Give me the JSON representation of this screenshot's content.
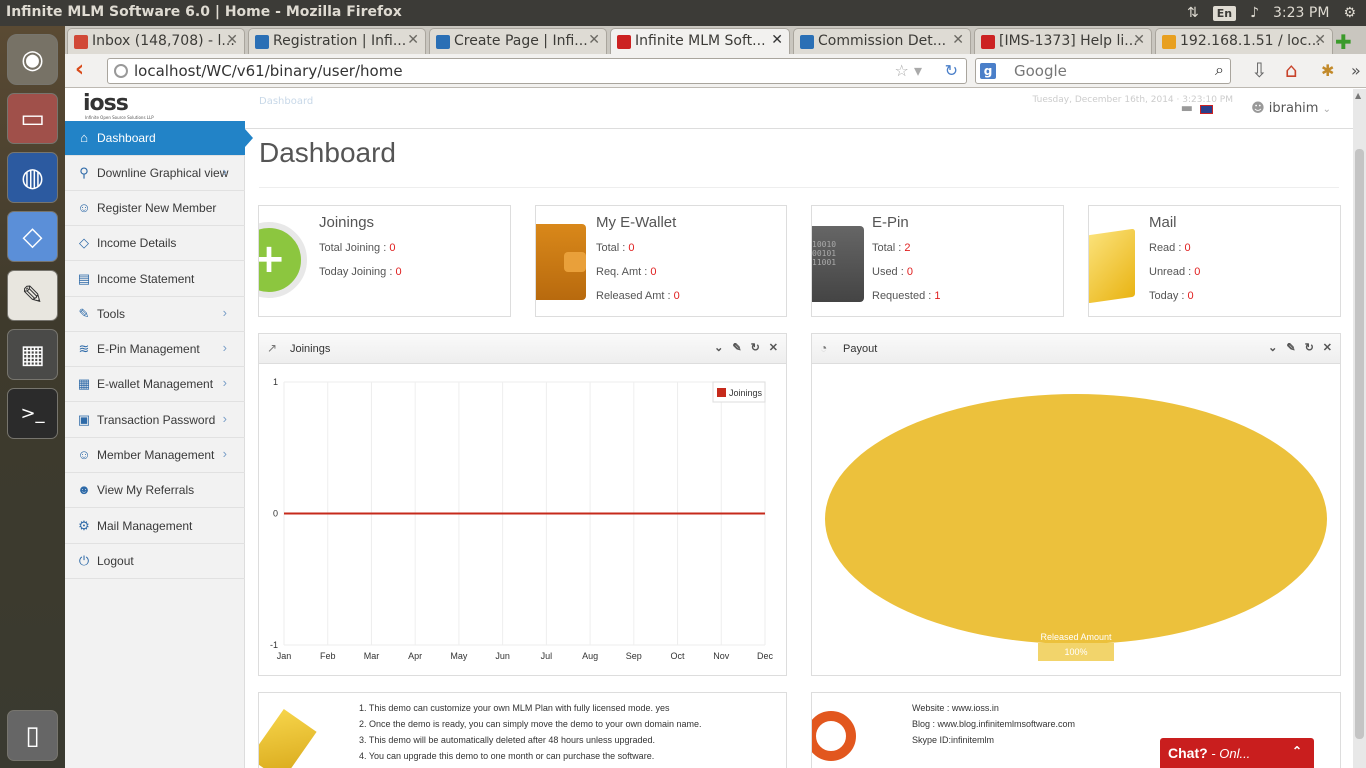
{
  "window": {
    "title": "Infinite MLM Software 6.0 | Home - Mozilla Firefox",
    "lang": "En",
    "clock": "3:23 PM"
  },
  "tabs": [
    {
      "label": "Inbox (148,708) - l...",
      "color": "#d14836"
    },
    {
      "label": "Registration | Infi...",
      "color": "#2a6fb5"
    },
    {
      "label": "Create Page | Infi...",
      "color": "#2a6fb5"
    },
    {
      "label": "Infinite MLM Soft...",
      "color": "#c22"
    },
    {
      "label": "Commission Det...",
      "color": "#2a6fb5"
    },
    {
      "label": "[IMS-1373] Help li...",
      "color": "#c22"
    },
    {
      "label": "192.168.1.51 / loc...",
      "color": "#e8a020"
    }
  ],
  "urlbar": {
    "url": "localhost/WC/v61/binary/user/home"
  },
  "searchbar": {
    "placeholder": "Google"
  },
  "logo": {
    "text": "ioss",
    "subtitle": "Infinite Open Source Solutions LLP"
  },
  "header": {
    "breadcrumb": "Dashboard",
    "date": "Tuesday, December 16th, 2014 · 3:23:10 PM",
    "user": "ibrahim"
  },
  "sidebar": {
    "items": [
      {
        "label": "Dashboard",
        "icon": "home-icon",
        "glyph": "⌂"
      },
      {
        "label": "Downline Graphical view",
        "icon": "tree-icon",
        "glyph": "⚲"
      },
      {
        "label": "Register New Member",
        "icon": "user-add-icon",
        "glyph": "☺"
      },
      {
        "label": "Income Details",
        "icon": "diamond-icon",
        "glyph": "◇"
      },
      {
        "label": "Income Statement",
        "icon": "document-icon",
        "glyph": "▤"
      },
      {
        "label": "Tools",
        "icon": "wrench-icon",
        "glyph": "✎"
      },
      {
        "label": "E-Pin Management",
        "icon": "layers-icon",
        "glyph": "≋"
      },
      {
        "label": "E-wallet Management",
        "icon": "grid-icon",
        "glyph": "▦"
      },
      {
        "label": "Transaction Password",
        "icon": "lock-icon",
        "glyph": "▣"
      },
      {
        "label": "Member Management",
        "icon": "user-icon",
        "glyph": "☺"
      },
      {
        "label": "View My Referrals",
        "icon": "users-icon",
        "glyph": "☻"
      },
      {
        "label": "Mail Management",
        "icon": "gear-icon",
        "glyph": "⚙"
      },
      {
        "label": "Logout",
        "icon": "power-icon",
        "glyph": "⏻"
      }
    ]
  },
  "page": {
    "title": "Dashboard"
  },
  "stats": {
    "joinings": {
      "title": "Joinings",
      "total_label": "Total Joining : ",
      "total": "0",
      "today_label": "Today Joining : ",
      "today": "0"
    },
    "wallet": {
      "title": "My E-Wallet",
      "total_label": "Total : ",
      "total": "0",
      "req_label": "Req. Amt : ",
      "req": "0",
      "rel_label": "Released Amt : ",
      "rel": "0"
    },
    "epin": {
      "title": "E-Pin",
      "total_label": "Total : ",
      "total": "2",
      "used_label": "Used : ",
      "used": "0",
      "req_label": "Requested : ",
      "req": "1"
    },
    "mail": {
      "title": "Mail",
      "read_label": "Read : ",
      "read": "0",
      "unread_label": "Unread : ",
      "unread": "0",
      "today_label": "Today : ",
      "today": "0"
    }
  },
  "widgets": {
    "joinings": "Joinings",
    "payout": "Payout"
  },
  "chart_data": [
    {
      "type": "line",
      "title": "Joinings",
      "categories": [
        "Jan",
        "Feb",
        "Mar",
        "Apr",
        "May",
        "Jun",
        "Jul",
        "Aug",
        "Sep",
        "Oct",
        "Nov",
        "Dec"
      ],
      "series": [
        {
          "name": "Joinings",
          "values": [
            0,
            0,
            0,
            0,
            0,
            0,
            0,
            0,
            0,
            0,
            0,
            0
          ],
          "color": "#c62a1b"
        }
      ],
      "ylim": [
        -1,
        1
      ],
      "yticks": [
        "1",
        "0",
        "-1"
      ],
      "legend": "top-right",
      "grid": true
    },
    {
      "type": "pie",
      "title": "Payout",
      "slices": [
        {
          "label": "Released Amount",
          "value": 100,
          "percent": "100%",
          "color": "#ecc13c"
        }
      ]
    }
  ],
  "info_left": [
    "1. This demo can customize your own MLM Plan with fully licensed mode. yes",
    "2. Once the demo is ready, you can simply move the demo to your own domain name.",
    "3. This demo will be automatically deleted after 48 hours unless upgraded.",
    "4. You can upgrade this demo to one month or can purchase the software."
  ],
  "info_right": [
    "Website : www.ioss.in",
    "Blog : www.blog.infinitemlmsoftware.com",
    "Skype ID:infinitemlm"
  ],
  "chat": {
    "label": "Chat?",
    "status": " - Onl..."
  }
}
